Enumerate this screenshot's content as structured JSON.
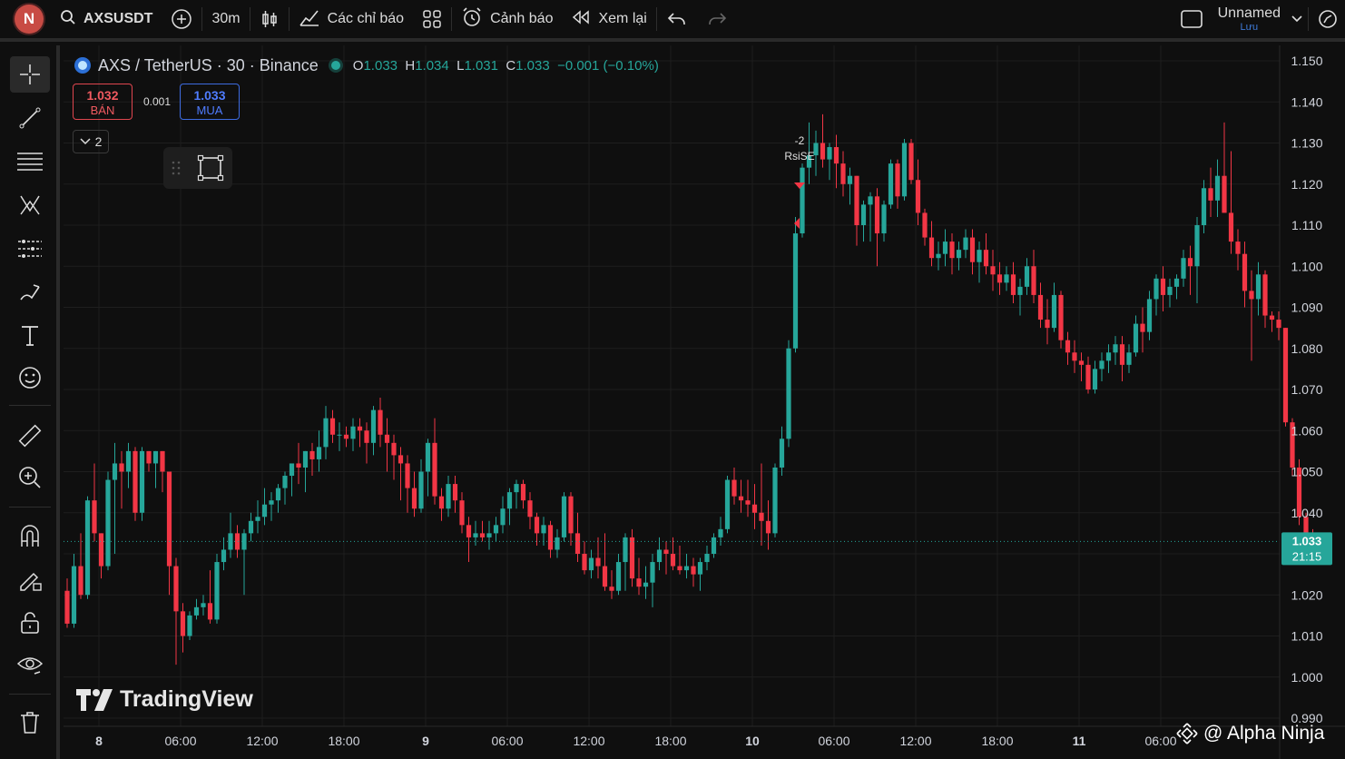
{
  "topbar": {
    "avatar_letter": "N",
    "symbol": "AXSUSDT",
    "interval": "30m",
    "indicators_label": "Các chỉ báo",
    "alerts_label": "Cảnh báo",
    "replay_label": "Xem lại",
    "layout_name": "Unnamed",
    "layout_save": "Lưu"
  },
  "legend": {
    "title": "AXS / TetherUS · 30 · Binance",
    "o_label": "O",
    "o_value": "1.033",
    "h_label": "H",
    "h_value": "1.034",
    "l_label": "L",
    "l_value": "1.031",
    "c_label": "C",
    "c_value": "1.033",
    "change": "−0.001 (−0.10%)"
  },
  "trade": {
    "sell_price": "1.032",
    "sell_label": "BÁN",
    "spread": "0.001",
    "buy_price": "1.033",
    "buy_label": "MUA",
    "collapse_count": "2"
  },
  "strategy_label": {
    "value": "-2",
    "name": "RsiSE"
  },
  "watermark": "TradingView",
  "credit": "@ Alpha Ninja",
  "colors": {
    "up": "#26a69a",
    "down": "#f23645",
    "bg": "#0f0f0f",
    "grid": "#1e1e1e",
    "price_tag": "#26a69a"
  },
  "chart_data": {
    "type": "candlestick",
    "ylim": [
      0.99,
      1.15
    ],
    "y_ticks": [
      "1.150",
      "1.140",
      "1.130",
      "1.120",
      "1.110",
      "1.100",
      "1.090",
      "1.080",
      "1.070",
      "1.060",
      "1.050",
      "1.040",
      "1.030",
      "1.020",
      "1.010",
      "1.000",
      "0.990"
    ],
    "x_ticks": [
      "8",
      "06:00",
      "12:00",
      "18:00",
      "9",
      "06:00",
      "12:00",
      "18:00",
      "10",
      "06:00",
      "12:00",
      "18:00",
      "11",
      "06:00"
    ],
    "last_price": "1.033",
    "countdown": "21:15",
    "series": [
      {
        "name": "AXSUSDT",
        "ohlc": [
          [
            1.021,
            1.024,
            1.012,
            1.013
          ],
          [
            1.013,
            1.03,
            1.012,
            1.027
          ],
          [
            1.027,
            1.035,
            1.019,
            1.02
          ],
          [
            1.02,
            1.044,
            1.019,
            1.043
          ],
          [
            1.043,
            1.052,
            1.033,
            1.035
          ],
          [
            1.035,
            1.031,
            1.024,
            1.027
          ],
          [
            1.027,
            1.05,
            1.026,
            1.048
          ],
          [
            1.048,
            1.057,
            1.03,
            1.052
          ],
          [
            1.052,
            1.055,
            1.041,
            1.05
          ],
          [
            1.05,
            1.057,
            1.046,
            1.055
          ],
          [
            1.055,
            1.056,
            1.038,
            1.04
          ],
          [
            1.04,
            1.056,
            1.038,
            1.055
          ],
          [
            1.055,
            1.052,
            1.05,
            1.052
          ],
          [
            1.052,
            1.055,
            1.046,
            1.055
          ],
          [
            1.055,
            1.054,
            1.045,
            1.05
          ],
          [
            1.05,
            1.05,
            1.02,
            1.027
          ],
          [
            1.027,
            1.029,
            1.003,
            1.016
          ],
          [
            1.016,
            1.018,
            1.006,
            1.01
          ],
          [
            1.01,
            1.016,
            1.009,
            1.015
          ],
          [
            1.015,
            1.019,
            1.014,
            1.017
          ],
          [
            1.017,
            1.02,
            1.015,
            1.018
          ],
          [
            1.018,
            1.026,
            1.013,
            1.014
          ],
          [
            1.014,
            1.03,
            1.013,
            1.028
          ],
          [
            1.028,
            1.034,
            1.026,
            1.031
          ],
          [
            1.031,
            1.04,
            1.029,
            1.035
          ],
          [
            1.035,
            1.037,
            1.029,
            1.031
          ],
          [
            1.031,
            1.036,
            1.02,
            1.035
          ],
          [
            1.035,
            1.04,
            1.033,
            1.038
          ],
          [
            1.038,
            1.043,
            1.035,
            1.039
          ],
          [
            1.039,
            1.046,
            1.037,
            1.042
          ],
          [
            1.042,
            1.045,
            1.038,
            1.043
          ],
          [
            1.043,
            1.047,
            1.04,
            1.046
          ],
          [
            1.046,
            1.05,
            1.042,
            1.049
          ],
          [
            1.049,
            1.052,
            1.044,
            1.052
          ],
          [
            1.052,
            1.057,
            1.047,
            1.051
          ],
          [
            1.051,
            1.055,
            1.045,
            1.055
          ],
          [
            1.055,
            1.057,
            1.049,
            1.053
          ],
          [
            1.053,
            1.06,
            1.05,
            1.056
          ],
          [
            1.056,
            1.066,
            1.053,
            1.063
          ],
          [
            1.063,
            1.065,
            1.057,
            1.059
          ],
          [
            1.059,
            1.062,
            1.055,
            1.059
          ],
          [
            1.059,
            1.061,
            1.056,
            1.058
          ],
          [
            1.058,
            1.063,
            1.055,
            1.061
          ],
          [
            1.061,
            1.063,
            1.056,
            1.06
          ],
          [
            1.06,
            1.062,
            1.052,
            1.057
          ],
          [
            1.057,
            1.066,
            1.054,
            1.065
          ],
          [
            1.065,
            1.068,
            1.056,
            1.059
          ],
          [
            1.059,
            1.063,
            1.05,
            1.057
          ],
          [
            1.057,
            1.059,
            1.048,
            1.054
          ],
          [
            1.054,
            1.056,
            1.043,
            1.052
          ],
          [
            1.052,
            1.054,
            1.04,
            1.046
          ],
          [
            1.046,
            1.05,
            1.039,
            1.041
          ],
          [
            1.041,
            1.053,
            1.04,
            1.05
          ],
          [
            1.05,
            1.058,
            1.044,
            1.057
          ],
          [
            1.057,
            1.063,
            1.042,
            1.044
          ],
          [
            1.044,
            1.046,
            1.038,
            1.041
          ],
          [
            1.041,
            1.049,
            1.039,
            1.047
          ],
          [
            1.047,
            1.049,
            1.04,
            1.043
          ],
          [
            1.043,
            1.045,
            1.035,
            1.037
          ],
          [
            1.037,
            1.039,
            1.028,
            1.034
          ],
          [
            1.034,
            1.038,
            1.032,
            1.035
          ],
          [
            1.035,
            1.038,
            1.033,
            1.034
          ],
          [
            1.034,
            1.038,
            1.031,
            1.035
          ],
          [
            1.035,
            1.039,
            1.033,
            1.037
          ],
          [
            1.037,
            1.044,
            1.035,
            1.041
          ],
          [
            1.041,
            1.046,
            1.037,
            1.045
          ],
          [
            1.045,
            1.048,
            1.041,
            1.047
          ],
          [
            1.047,
            1.048,
            1.041,
            1.043
          ],
          [
            1.043,
            1.045,
            1.036,
            1.039
          ],
          [
            1.039,
            1.04,
            1.032,
            1.035
          ],
          [
            1.035,
            1.039,
            1.032,
            1.037
          ],
          [
            1.037,
            1.038,
            1.029,
            1.031
          ],
          [
            1.031,
            1.036,
            1.029,
            1.034
          ],
          [
            1.034,
            1.045,
            1.033,
            1.044
          ],
          [
            1.044,
            1.045,
            1.032,
            1.035
          ],
          [
            1.035,
            1.04,
            1.028,
            1.03
          ],
          [
            1.03,
            1.033,
            1.025,
            1.026
          ],
          [
            1.026,
            1.031,
            1.024,
            1.029
          ],
          [
            1.029,
            1.034,
            1.024,
            1.027
          ],
          [
            1.027,
            1.035,
            1.021,
            1.022
          ],
          [
            1.022,
            1.026,
            1.019,
            1.021
          ],
          [
            1.021,
            1.03,
            1.02,
            1.028
          ],
          [
            1.028,
            1.035,
            1.021,
            1.034
          ],
          [
            1.034,
            1.036,
            1.022,
            1.024
          ],
          [
            1.024,
            1.029,
            1.02,
            1.022
          ],
          [
            1.022,
            1.027,
            1.019,
            1.023
          ],
          [
            1.023,
            1.03,
            1.017,
            1.028
          ],
          [
            1.028,
            1.034,
            1.026,
            1.031
          ],
          [
            1.031,
            1.033,
            1.025,
            1.03
          ],
          [
            1.03,
            1.034,
            1.026,
            1.027
          ],
          [
            1.027,
            1.032,
            1.025,
            1.026
          ],
          [
            1.026,
            1.03,
            1.024,
            1.027
          ],
          [
            1.027,
            1.029,
            1.022,
            1.025
          ],
          [
            1.025,
            1.029,
            1.021,
            1.028
          ],
          [
            1.028,
            1.032,
            1.026,
            1.03
          ],
          [
            1.03,
            1.035,
            1.029,
            1.034
          ],
          [
            1.034,
            1.039,
            1.032,
            1.036
          ],
          [
            1.036,
            1.049,
            1.035,
            1.048
          ],
          [
            1.048,
            1.051,
            1.042,
            1.044
          ],
          [
            1.044,
            1.048,
            1.04,
            1.043
          ],
          [
            1.043,
            1.048,
            1.039,
            1.042
          ],
          [
            1.042,
            1.047,
            1.036,
            1.04
          ],
          [
            1.04,
            1.052,
            1.032,
            1.038
          ],
          [
            1.038,
            1.043,
            1.031,
            1.035
          ],
          [
            1.035,
            1.052,
            1.034,
            1.051
          ],
          [
            1.051,
            1.061,
            1.049,
            1.058
          ],
          [
            1.058,
            1.082,
            1.056,
            1.08
          ],
          [
            1.08,
            1.112,
            1.079,
            1.108
          ],
          [
            1.108,
            1.125,
            1.107,
            1.124
          ],
          [
            1.124,
            1.135,
            1.12,
            1.127
          ],
          [
            1.127,
            1.133,
            1.122,
            1.13
          ],
          [
            1.13,
            1.137,
            1.124,
            1.126
          ],
          [
            1.126,
            1.13,
            1.121,
            1.129
          ],
          [
            1.129,
            1.132,
            1.119,
            1.125
          ],
          [
            1.125,
            1.128,
            1.117,
            1.12
          ],
          [
            1.12,
            1.124,
            1.115,
            1.122
          ],
          [
            1.122,
            1.121,
            1.105,
            1.11
          ],
          [
            1.11,
            1.116,
            1.106,
            1.115
          ],
          [
            1.115,
            1.118,
            1.106,
            1.117
          ],
          [
            1.117,
            1.119,
            1.1,
            1.108
          ],
          [
            1.108,
            1.116,
            1.106,
            1.115
          ],
          [
            1.115,
            1.126,
            1.114,
            1.125
          ],
          [
            1.125,
            1.126,
            1.114,
            1.117
          ],
          [
            1.117,
            1.131,
            1.116,
            1.13
          ],
          [
            1.13,
            1.131,
            1.12,
            1.121
          ],
          [
            1.121,
            1.126,
            1.11,
            1.113
          ],
          [
            1.113,
            1.114,
            1.105,
            1.107
          ],
          [
            1.107,
            1.111,
            1.1,
            1.102
          ],
          [
            1.102,
            1.106,
            1.099,
            1.103
          ],
          [
            1.103,
            1.109,
            1.1,
            1.106
          ],
          [
            1.106,
            1.108,
            1.098,
            1.102
          ],
          [
            1.102,
            1.106,
            1.099,
            1.104
          ],
          [
            1.104,
            1.109,
            1.102,
            1.107
          ],
          [
            1.107,
            1.109,
            1.098,
            1.101
          ],
          [
            1.101,
            1.106,
            1.096,
            1.104
          ],
          [
            1.104,
            1.108,
            1.098,
            1.1
          ],
          [
            1.1,
            1.104,
            1.094,
            1.098
          ],
          [
            1.098,
            1.101,
            1.093,
            1.096
          ],
          [
            1.096,
            1.1,
            1.094,
            1.098
          ],
          [
            1.098,
            1.101,
            1.091,
            1.093
          ],
          [
            1.093,
            1.097,
            1.088,
            1.095
          ],
          [
            1.095,
            1.102,
            1.093,
            1.1
          ],
          [
            1.1,
            1.104,
            1.091,
            1.093
          ],
          [
            1.093,
            1.096,
            1.085,
            1.087
          ],
          [
            1.087,
            1.092,
            1.081,
            1.085
          ],
          [
            1.085,
            1.096,
            1.084,
            1.093
          ],
          [
            1.093,
            1.094,
            1.08,
            1.082
          ],
          [
            1.082,
            1.084,
            1.076,
            1.079
          ],
          [
            1.079,
            1.082,
            1.074,
            1.077
          ],
          [
            1.077,
            1.079,
            1.072,
            1.076
          ],
          [
            1.076,
            1.078,
            1.069,
            1.07
          ],
          [
            1.07,
            1.077,
            1.069,
            1.075
          ],
          [
            1.075,
            1.079,
            1.072,
            1.077
          ],
          [
            1.077,
            1.081,
            1.074,
            1.079
          ],
          [
            1.079,
            1.083,
            1.076,
            1.081
          ],
          [
            1.081,
            1.083,
            1.072,
            1.076
          ],
          [
            1.076,
            1.081,
            1.074,
            1.079
          ],
          [
            1.079,
            1.088,
            1.078,
            1.086
          ],
          [
            1.086,
            1.09,
            1.079,
            1.084
          ],
          [
            1.084,
            1.094,
            1.082,
            1.092
          ],
          [
            1.092,
            1.098,
            1.088,
            1.097
          ],
          [
            1.097,
            1.1,
            1.089,
            1.093
          ],
          [
            1.093,
            1.097,
            1.09,
            1.095
          ],
          [
            1.095,
            1.098,
            1.092,
            1.097
          ],
          [
            1.097,
            1.104,
            1.095,
            1.102
          ],
          [
            1.102,
            1.105,
            1.093,
            1.1
          ],
          [
            1.1,
            1.112,
            1.091,
            1.11
          ],
          [
            1.11,
            1.121,
            1.108,
            1.119
          ],
          [
            1.119,
            1.124,
            1.112,
            1.116
          ],
          [
            1.116,
            1.126,
            1.112,
            1.122
          ],
          [
            1.122,
            1.135,
            1.115,
            1.113
          ],
          [
            1.113,
            1.128,
            1.103,
            1.106
          ],
          [
            1.106,
            1.109,
            1.099,
            1.103
          ],
          [
            1.103,
            1.106,
            1.09,
            1.094
          ],
          [
            1.094,
            1.099,
            1.077,
            1.092
          ],
          [
            1.092,
            1.101,
            1.088,
            1.098
          ],
          [
            1.098,
            1.099,
            1.085,
            1.088
          ],
          [
            1.088,
            1.089,
            1.084,
            1.087
          ],
          [
            1.087,
            1.089,
            1.082,
            1.085
          ],
          [
            1.085,
            1.085,
            1.061,
            1.062
          ],
          [
            1.062,
            1.063,
            1.049,
            1.051
          ],
          [
            1.051,
            1.053,
            1.037,
            1.039
          ],
          [
            1.039,
            1.04,
            1.028,
            1.035
          ],
          [
            1.035,
            1.036,
            1.031,
            1.033
          ]
        ]
      }
    ]
  }
}
